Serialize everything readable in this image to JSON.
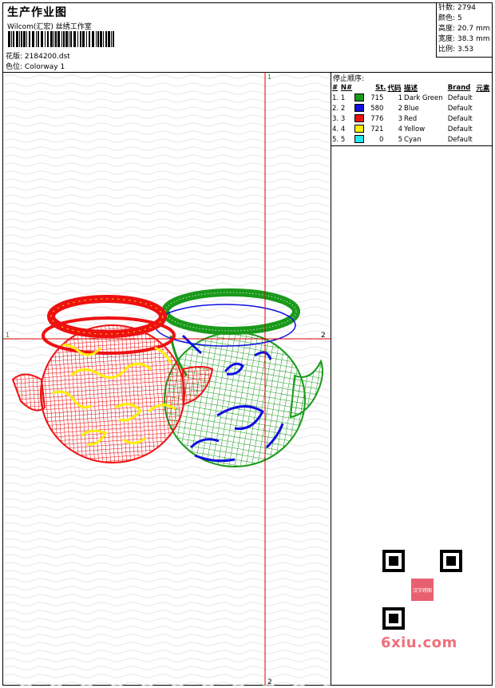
{
  "header": {
    "title": "生产作业图",
    "company": "Wilcom(汇宏) 丝绣工作室",
    "design_label": "花版:",
    "design_value": "2184200.dst",
    "colorway_label": "色位:",
    "colorway_value": "Colorway 1"
  },
  "stats": [
    {
      "label": "针数:",
      "value": "2794"
    },
    {
      "label": "颜色:",
      "value": "5"
    },
    {
      "label": "高度:",
      "value": "20.7 mm"
    },
    {
      "label": "宽度:",
      "value": "38.3 mm"
    },
    {
      "label": "比例:",
      "value": "3.53"
    }
  ],
  "canvas": {
    "markers": {
      "top": "1",
      "left": "1",
      "right": "2",
      "bottom": "2"
    },
    "crosshair_color": "#dd0000"
  },
  "stop_panel": {
    "title": "停止顺序:",
    "columns": [
      "#",
      "N#",
      "St.",
      "代码",
      "描述",
      "Brand",
      "元素"
    ],
    "rows": [
      {
        "idx": "1.",
        "n": "1",
        "color": "#1a9a1a",
        "stitches": "715",
        "code": "1",
        "desc": "Dark Green",
        "brand": "Default"
      },
      {
        "idx": "2.",
        "n": "2",
        "color": "#1010e0",
        "stitches": "580",
        "code": "2",
        "desc": "Blue",
        "brand": "Default"
      },
      {
        "idx": "3.",
        "n": "3",
        "color": "#ee1111",
        "stitches": "776",
        "code": "3",
        "desc": "Red",
        "brand": "Default"
      },
      {
        "idx": "4.",
        "n": "4",
        "color": "#ffee00",
        "stitches": "721",
        "code": "4",
        "desc": "Yellow",
        "brand": "Default"
      },
      {
        "idx": "5.",
        "n": "5",
        "color": "#22e8f0",
        "stitches": "0",
        "code": "5",
        "desc": "Cyan",
        "brand": "Default"
      }
    ]
  },
  "watermark": "6xiu.com",
  "qr_badge": "汉字绣图"
}
